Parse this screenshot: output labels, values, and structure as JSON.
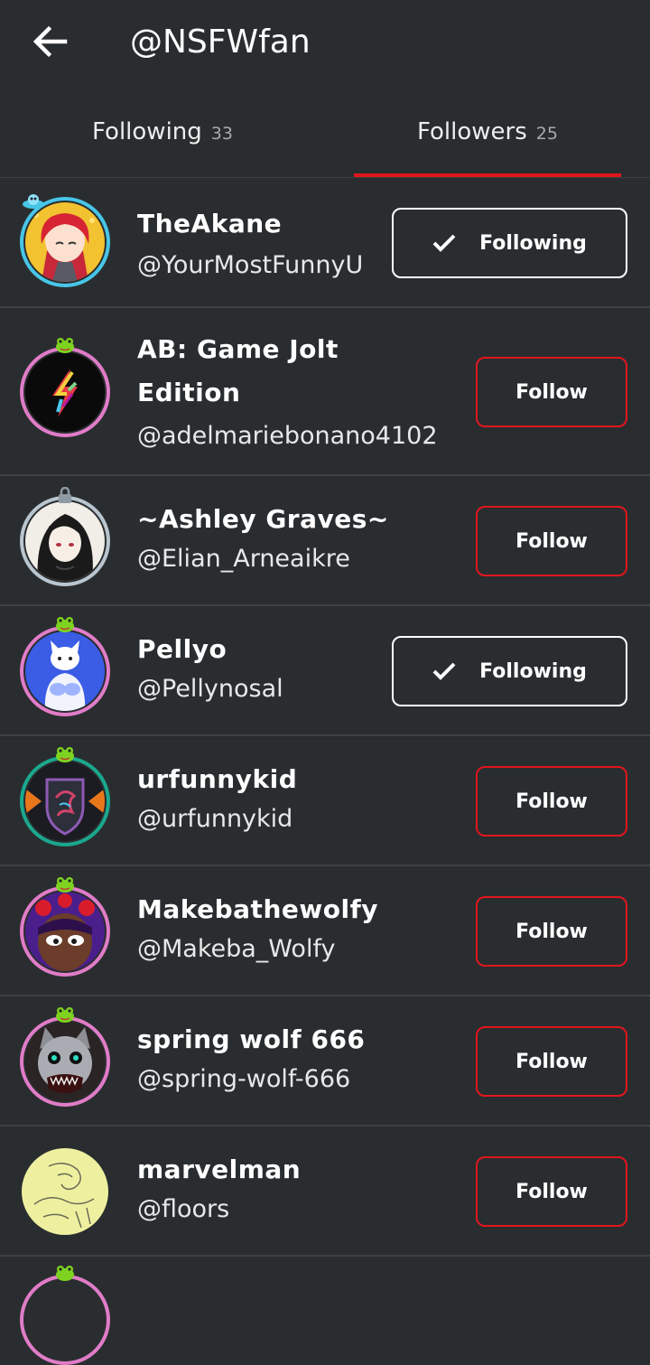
{
  "header": {
    "title": "@NSFWfan",
    "back_icon": "arrow-left-icon"
  },
  "tabs": [
    {
      "label": "Following",
      "count": "33",
      "selected": false
    },
    {
      "label": "Followers",
      "count": "25",
      "selected": true
    }
  ],
  "colors": {
    "background": "#2a2d2f",
    "accent": "#e0161e",
    "divider": "#3d4143"
  },
  "users": [
    {
      "name": "TheAkane",
      "handle": "@YourMostFunnyU",
      "button": "Following",
      "button_state": "following",
      "avatar_icon": "anime-girl-avatar"
    },
    {
      "name": "AB: Game Jolt Edition",
      "handle": "@adelmariebonano4102",
      "button": "Follow",
      "button_state": "follow",
      "avatar_icon": "rainbow-bolt-avatar"
    },
    {
      "name": "~Ashley Graves~",
      "handle": "@Elian_Arneaikre",
      "button": "Follow",
      "button_state": "follow",
      "avatar_icon": "sketch-girl-avatar"
    },
    {
      "name": "Pellyo",
      "handle": "@Pellynosal",
      "button": "Following",
      "button_state": "following",
      "avatar_icon": "white-cat-avatar"
    },
    {
      "name": "urfunnykid",
      "handle": "@urfunnykid",
      "button": "Follow",
      "button_state": "follow",
      "avatar_icon": "dragon-shield-avatar"
    },
    {
      "name": "Makebathewolfy",
      "handle": "@Makeba_Wolfy",
      "button": "Follow",
      "button_state": "follow",
      "avatar_icon": "purple-character-avatar"
    },
    {
      "name": "spring wolf 666",
      "handle": "@spring-wolf-666",
      "button": "Follow",
      "button_state": "follow",
      "avatar_icon": "wolf-animatronic-avatar"
    },
    {
      "name": "marvelman",
      "handle": "@floors",
      "button": "Follow",
      "button_state": "follow",
      "avatar_icon": "yellow-sketch-avatar"
    }
  ]
}
